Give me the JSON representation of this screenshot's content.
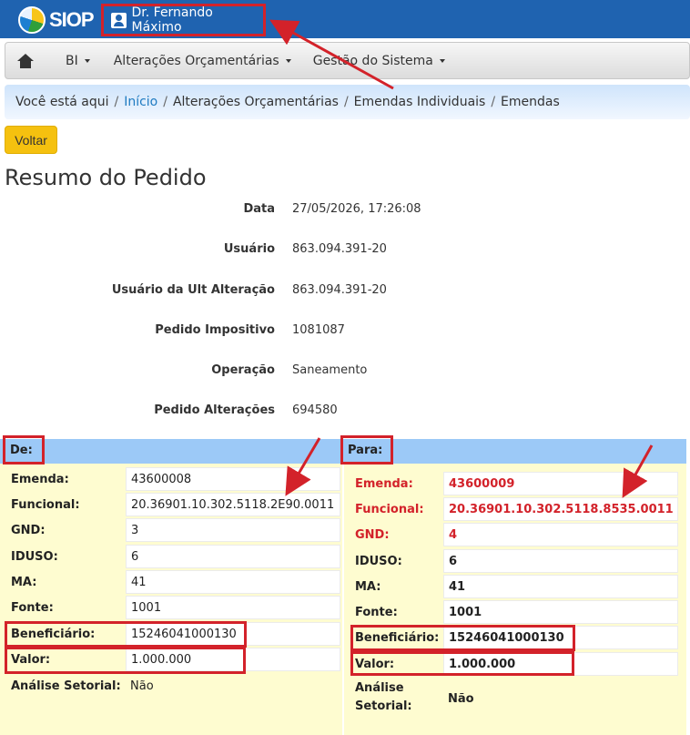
{
  "topbar": {
    "logo_text": "SIOP",
    "user_name": "Dr. Fernando Máximo"
  },
  "nav": {
    "items": [
      {
        "label": "BI"
      },
      {
        "label": "Alterações Orçamentárias"
      },
      {
        "label": "Gestão do Sistema"
      }
    ]
  },
  "breadcrumb": {
    "prefix": "Você está aqui",
    "items": [
      "Início",
      "Alterações Orçamentárias",
      "Emendas Individuais",
      "Emendas"
    ]
  },
  "back_button": "Voltar",
  "page_title": "Resumo do Pedido",
  "summary": [
    {
      "label": "Data",
      "value": "27/05/2026, 17:26:08"
    },
    {
      "label": "Usuário",
      "value": "863.094.391-20"
    },
    {
      "label": "Usuário da Ult Alteração",
      "value": "863.094.391-20"
    },
    {
      "label": "Pedido Impositivo",
      "value": "1081087"
    },
    {
      "label": "Operação",
      "value": "Saneamento"
    },
    {
      "label": "Pedido Alterações",
      "value": "694580"
    }
  ],
  "de": {
    "title": "De:",
    "rows": [
      {
        "label": "Emenda:",
        "value": "43600008"
      },
      {
        "label": "Funcional:",
        "value": "20.36901.10.302.5118.2E90.0011"
      },
      {
        "label": "GND:",
        "value": "3"
      },
      {
        "label": "IDUSO:",
        "value": "6"
      },
      {
        "label": "MA:",
        "value": "41"
      },
      {
        "label": "Fonte:",
        "value": "1001"
      },
      {
        "label": "Beneficiário:",
        "value": "15246041000130"
      },
      {
        "label": "Valor:",
        "value": "1.000.000"
      },
      {
        "label": "Análise Setorial:",
        "value": "Não"
      }
    ]
  },
  "para": {
    "title": "Para:",
    "rows": [
      {
        "label": "Emenda:",
        "value": "43600009"
      },
      {
        "label": "Funcional:",
        "value": "20.36901.10.302.5118.8535.0011"
      },
      {
        "label": "GND:",
        "value": "4"
      },
      {
        "label": "IDUSO:",
        "value": "6"
      },
      {
        "label": "MA:",
        "value": "41"
      },
      {
        "label": "Fonte:",
        "value": "1001"
      },
      {
        "label": "Beneficiário:",
        "value": "15246041000130"
      },
      {
        "label": "Valor:",
        "value": "1.000.000"
      },
      {
        "label": "Análise Setorial:",
        "value": "Não"
      }
    ]
  },
  "colors": {
    "topbar": "#1f63b0",
    "highlight": "#d3222a",
    "panel_header": "#9cc9f7",
    "panel_body": "#fefcd0",
    "voltar": "#f5c10f"
  }
}
